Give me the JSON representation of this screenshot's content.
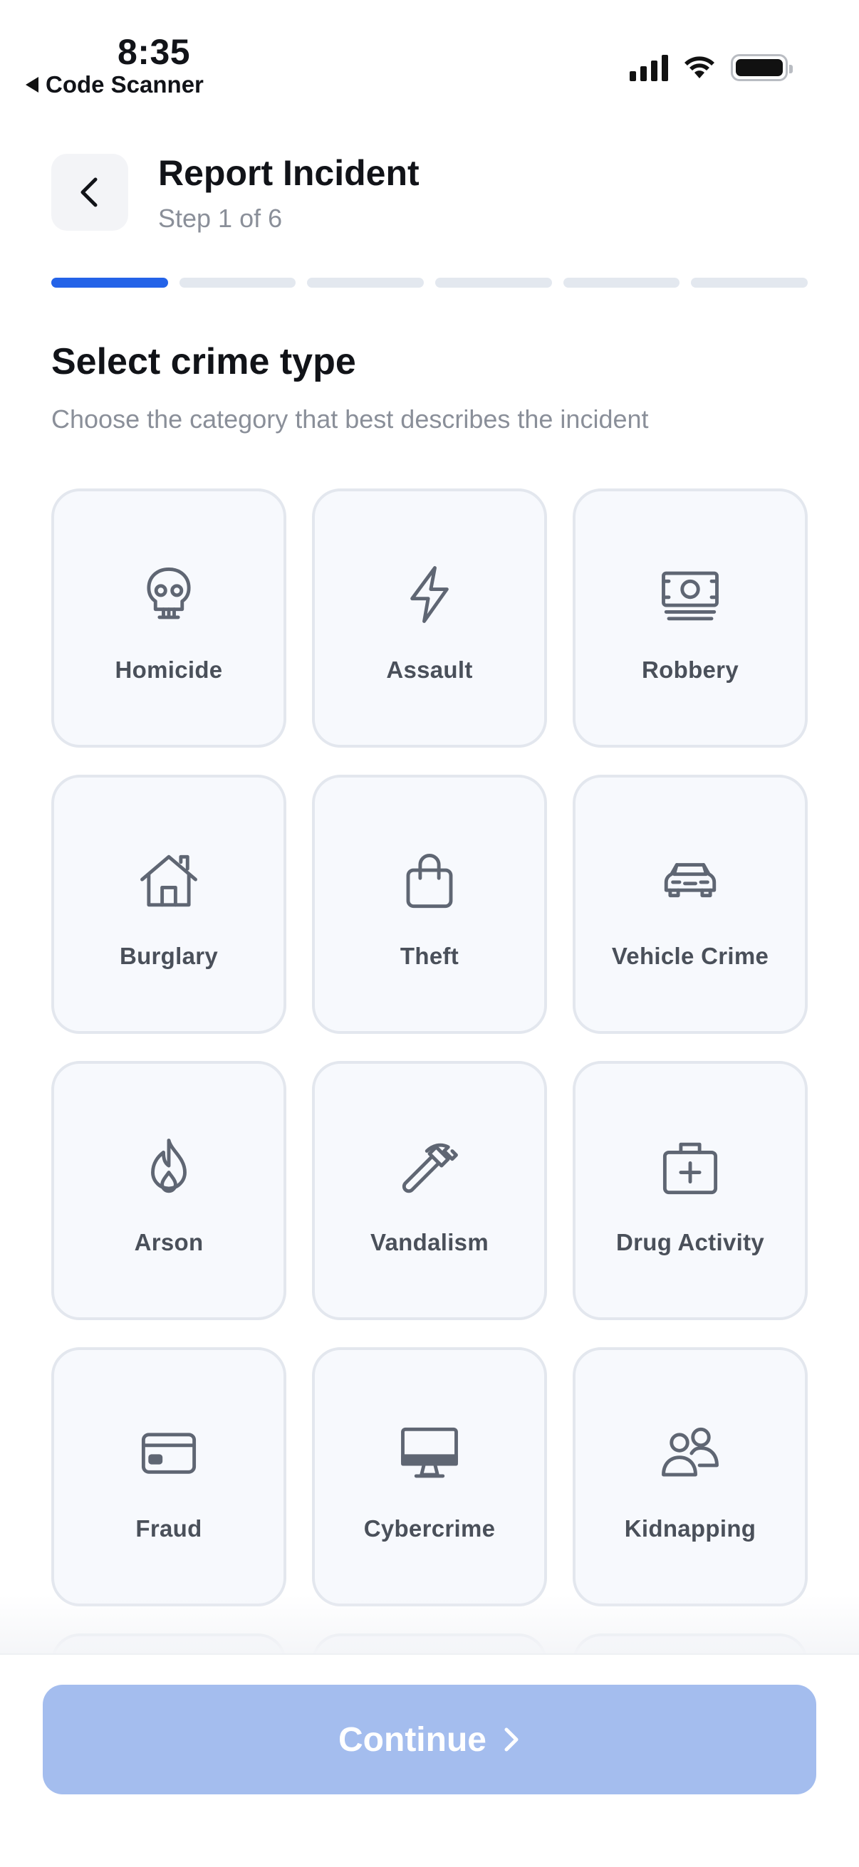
{
  "status_bar": {
    "time": "8:35",
    "back_app": "Code Scanner"
  },
  "header": {
    "title": "Report Incident",
    "step": "Step 1 of 6"
  },
  "progress": {
    "current_step": 1,
    "total_steps": 6,
    "active_color": "#2463e8",
    "inactive_color": "#e3e8ef"
  },
  "section": {
    "title": "Select crime type",
    "subtitle": "Choose the category that best describes the incident"
  },
  "crime_types": [
    {
      "label": "Homicide",
      "icon": "skull-icon"
    },
    {
      "label": "Assault",
      "icon": "lightning-icon"
    },
    {
      "label": "Robbery",
      "icon": "cash-icon"
    },
    {
      "label": "Burglary",
      "icon": "house-icon"
    },
    {
      "label": "Theft",
      "icon": "bag-icon"
    },
    {
      "label": "Vehicle Crime",
      "icon": "car-icon"
    },
    {
      "label": "Arson",
      "icon": "flame-icon"
    },
    {
      "label": "Vandalism",
      "icon": "hammer-icon"
    },
    {
      "label": "Drug Activity",
      "icon": "medkit-icon"
    },
    {
      "label": "Fraud",
      "icon": "credit-card-icon"
    },
    {
      "label": "Cybercrime",
      "icon": "computer-icon"
    },
    {
      "label": "Kidnapping",
      "icon": "people-icon"
    }
  ],
  "footer": {
    "continue_label": "Continue",
    "button_color": "#a4bdee"
  }
}
